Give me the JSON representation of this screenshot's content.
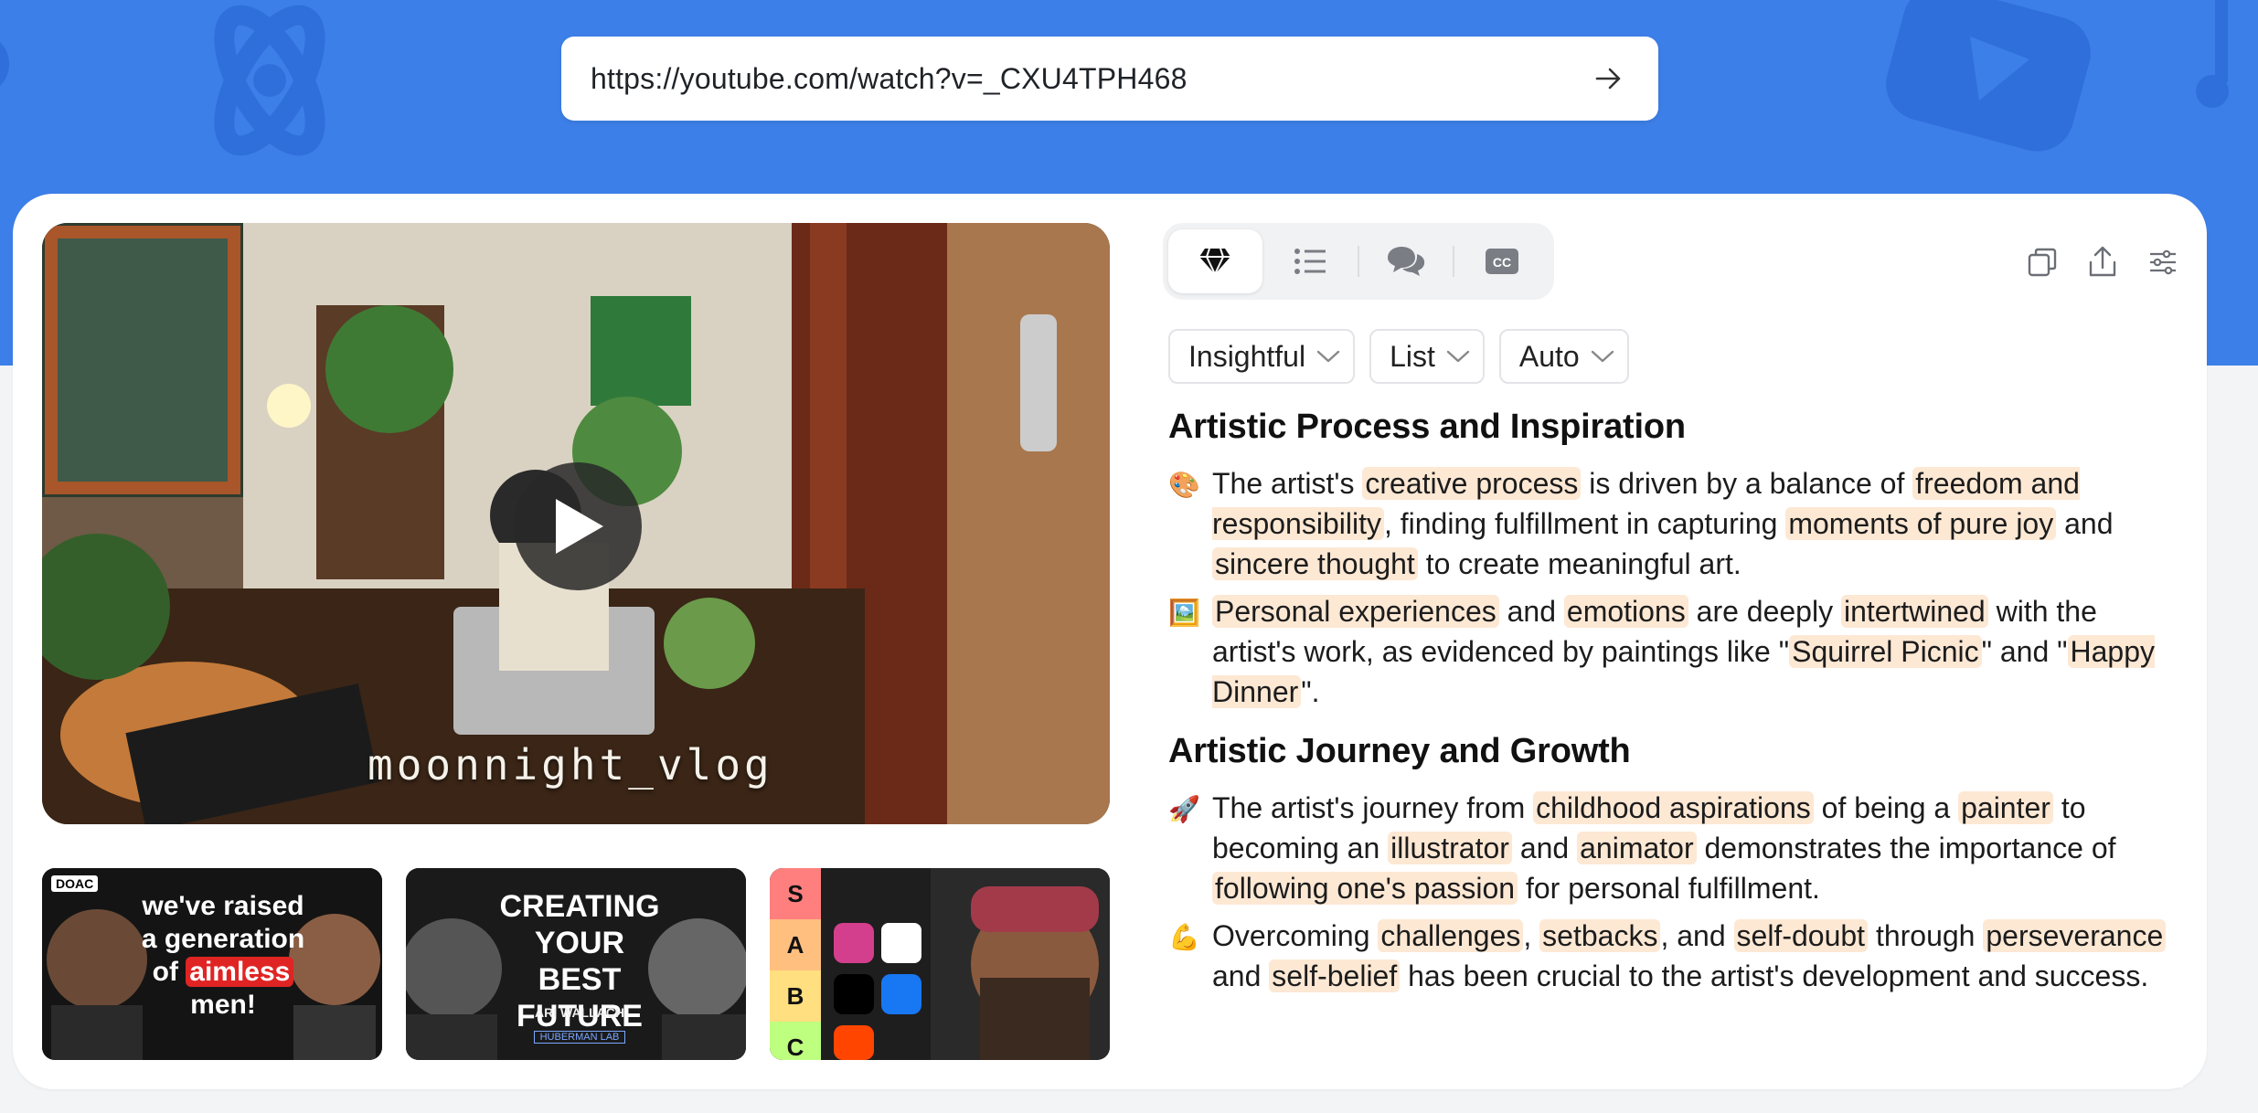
{
  "url_bar": {
    "value": "https://youtube.com/watch?v=_CXU4TPH468"
  },
  "video": {
    "watermark": "moonnight_vlog"
  },
  "thumbnails": [
    {
      "badge": "DOAC",
      "line1": "we've raised",
      "line2": "a generation",
      "line3_pre": "of ",
      "line3_hl": "aimless",
      "line4": "men!"
    },
    {
      "line1": "CREATING",
      "line2": "YOUR BEST",
      "line3": "FUTURE",
      "sub": "ARI WALLACH",
      "lab": "HUBERMAN LAB"
    },
    {
      "tiers": [
        "S",
        "A",
        "B",
        "C"
      ]
    }
  ],
  "tabs": [
    {
      "icon": "gem-icon"
    },
    {
      "icon": "list-icon"
    },
    {
      "icon": "chat-icon"
    },
    {
      "icon": "cc-icon"
    }
  ],
  "actions": [
    "copy-icon",
    "share-icon",
    "settings-sliders-icon"
  ],
  "filters": [
    {
      "label": "Insightful"
    },
    {
      "label": "List"
    },
    {
      "label": "Auto"
    }
  ],
  "sections": [
    {
      "title": "Artistic Process and Inspiration",
      "bullets": [
        {
          "emoji": "🎨",
          "parts": [
            {
              "t": "The artist's "
            },
            {
              "t": "creative process",
              "hl": true
            },
            {
              "t": " is driven by a balance of "
            },
            {
              "t": "freedom and responsibility",
              "hl": true
            },
            {
              "t": ", finding fulfillment in capturing "
            },
            {
              "t": "moments of pure joy",
              "hl": true
            },
            {
              "t": " and "
            },
            {
              "t": "sincere thought",
              "hl": true
            },
            {
              "t": " to create meaningful art."
            }
          ]
        },
        {
          "emoji": "🖼️",
          "parts": [
            {
              "t": "Personal experiences",
              "hl": true
            },
            {
              "t": " and "
            },
            {
              "t": "emotions",
              "hl": true
            },
            {
              "t": " are deeply "
            },
            {
              "t": "intertwined",
              "hl": true
            },
            {
              "t": " with the artist's work, as evidenced by paintings like \""
            },
            {
              "t": "Squirrel Picnic",
              "hl": true
            },
            {
              "t": "\" and \""
            },
            {
              "t": "Happy Dinner",
              "hl": true
            },
            {
              "t": "\"."
            }
          ]
        }
      ]
    },
    {
      "title": "Artistic Journey and Growth",
      "bullets": [
        {
          "emoji": "🚀",
          "parts": [
            {
              "t": "The artist's journey from "
            },
            {
              "t": "childhood aspirations",
              "hl": true
            },
            {
              "t": " of being a "
            },
            {
              "t": "painter",
              "hl": true
            },
            {
              "t": " to becoming an "
            },
            {
              "t": "illustrator",
              "hl": true
            },
            {
              "t": " and "
            },
            {
              "t": "animator",
              "hl": true
            },
            {
              "t": " demonstrates the importance of "
            },
            {
              "t": "following one's passion",
              "hl": true
            },
            {
              "t": " for personal fulfillment."
            }
          ]
        },
        {
          "emoji": "💪",
          "parts": [
            {
              "t": "Overcoming "
            },
            {
              "t": "challenges",
              "hl": true
            },
            {
              "t": ", "
            },
            {
              "t": "setbacks",
              "hl": true
            },
            {
              "t": ", and "
            },
            {
              "t": "self-doubt",
              "hl": true
            },
            {
              "t": " through "
            },
            {
              "t": "perseverance",
              "hl": true
            },
            {
              "t": " and "
            },
            {
              "t": "self-belief",
              "hl": true
            },
            {
              "t": " has been crucial to the artist's development and success."
            }
          ]
        }
      ]
    }
  ],
  "colors": {
    "brand": "#3d7fe8",
    "highlight": "#fde8d4"
  }
}
